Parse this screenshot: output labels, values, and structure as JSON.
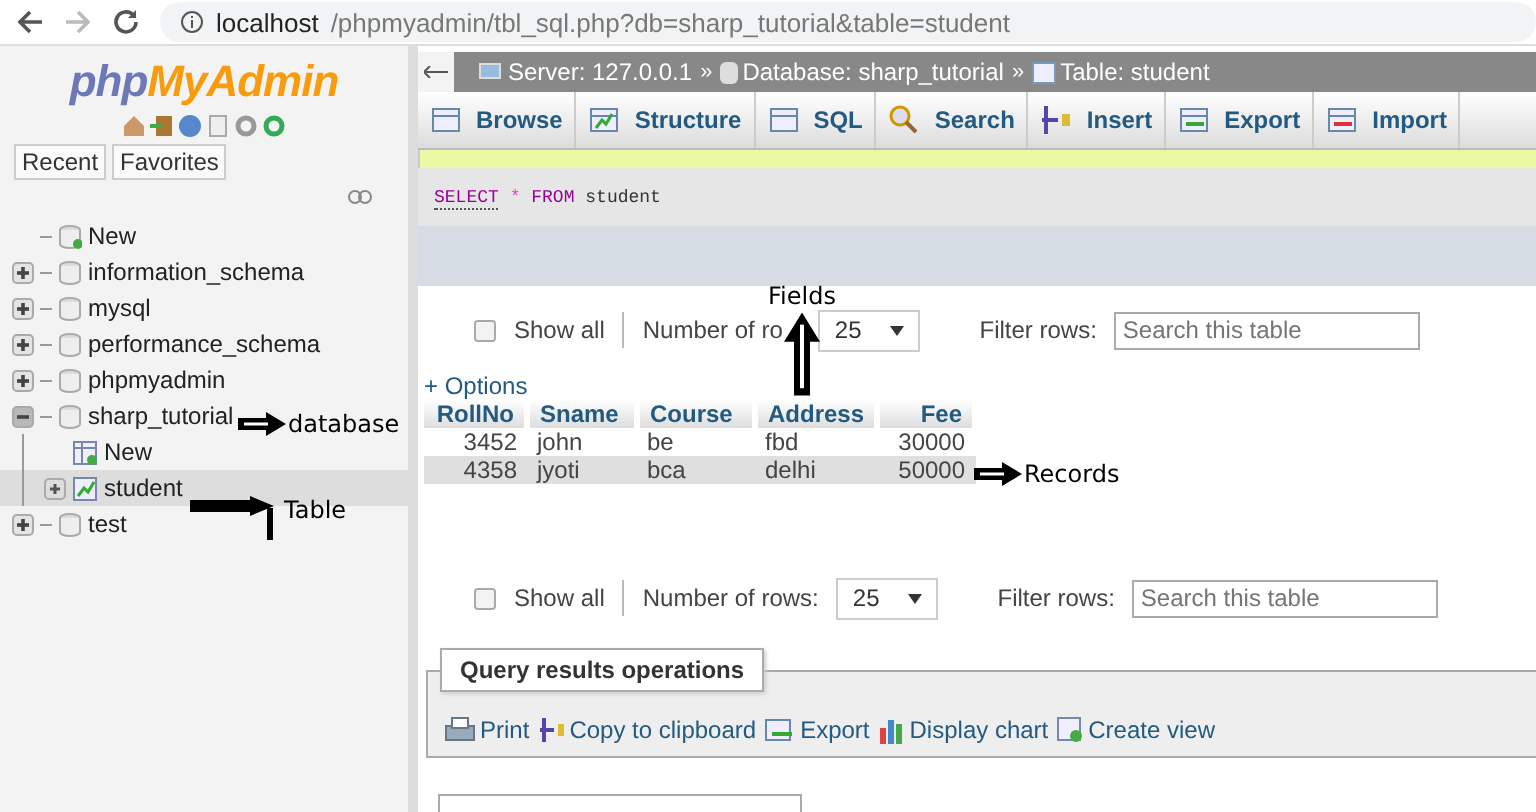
{
  "browser": {
    "url_host": "localhost",
    "url_path": "/phpmyadmin/tbl_sql.php?db=sharp_tutorial&table=student"
  },
  "sidebar": {
    "logo": {
      "first": "php",
      "second": "MyAdmin"
    },
    "buttons": [
      "Recent",
      "Favorites"
    ],
    "tree": [
      {
        "label": "New",
        "kind": "new",
        "selected": false
      },
      {
        "label": "information_schema",
        "kind": "db",
        "expanded": false,
        "selected": false
      },
      {
        "label": "mysql",
        "kind": "db",
        "expanded": false,
        "selected": false
      },
      {
        "label": "performance_schema",
        "kind": "db",
        "expanded": false,
        "selected": false
      },
      {
        "label": "phpmyadmin",
        "kind": "db",
        "expanded": false,
        "selected": false
      },
      {
        "label": "sharp_tutorial",
        "kind": "db",
        "expanded": true,
        "selected": false,
        "children": [
          {
            "label": "New",
            "kind": "new_table",
            "selected": false
          },
          {
            "label": "student",
            "kind": "table",
            "selected": true
          }
        ]
      },
      {
        "label": "test",
        "kind": "db",
        "expanded": false,
        "selected": false
      }
    ]
  },
  "breadcrumb": [
    {
      "kind": "server",
      "label": "Server: 127.0.0.1"
    },
    {
      "kind": "sep",
      "label": "»"
    },
    {
      "kind": "database",
      "label": "Database: sharp_tutorial"
    },
    {
      "kind": "sep",
      "label": "»"
    },
    {
      "kind": "table",
      "label": "Table: student"
    }
  ],
  "tabs": [
    {
      "label": "Browse",
      "kind": "browse",
      "selected": false
    },
    {
      "label": "Structure",
      "kind": "structure",
      "selected": false
    },
    {
      "label": "SQL",
      "kind": "sql",
      "selected": false
    },
    {
      "label": "Search",
      "kind": "search",
      "selected": false
    },
    {
      "label": "Insert",
      "kind": "insert",
      "selected": false
    },
    {
      "label": "Export",
      "kind": "export",
      "selected": false
    },
    {
      "label": "Import",
      "kind": "import",
      "selected": false
    }
  ],
  "query": [
    {
      "kind": "keyword",
      "text": "SELECT"
    },
    {
      "kind": "star",
      "text": "*"
    },
    {
      "kind": "keyword",
      "text": "FROM"
    },
    {
      "kind": "name",
      "text": "student"
    }
  ],
  "navigation": [
    {
      "show_all": "Show all",
      "checked": false,
      "rows_label": "Number of ro",
      "rows": "25",
      "filter_label": "Filter rows:",
      "placeholder": "Search this table"
    },
    {
      "show_all": "Show all",
      "checked": false,
      "rows_label": "Number of rows:",
      "rows": "25",
      "filter_label": "Filter rows:",
      "placeholder": "Search this table"
    }
  ],
  "options_link": "+ Options",
  "table": {
    "columns": [
      "RollNo",
      "Sname",
      "Course",
      "Address",
      "Fee"
    ],
    "rows": [
      [
        "3452",
        "john",
        "be",
        "fbd",
        "30000"
      ],
      [
        "4358",
        "jyoti",
        "bca",
        "delhi",
        "50000"
      ]
    ]
  },
  "operations": {
    "title": "Query results operations",
    "actions": [
      {
        "label": "Print",
        "kind": "print"
      },
      {
        "label": "Copy to clipboard",
        "kind": "copy"
      },
      {
        "label": "Export",
        "kind": "export"
      },
      {
        "label": "Display chart",
        "kind": "chart"
      },
      {
        "label": "Create view",
        "kind": "view"
      }
    ]
  },
  "annotations": [
    {
      "text": "database",
      "kind": "right"
    },
    {
      "text": "Table",
      "kind": "hook"
    },
    {
      "text": "Fields",
      "kind": "up"
    },
    {
      "text": "Records",
      "kind": "right"
    }
  ]
}
